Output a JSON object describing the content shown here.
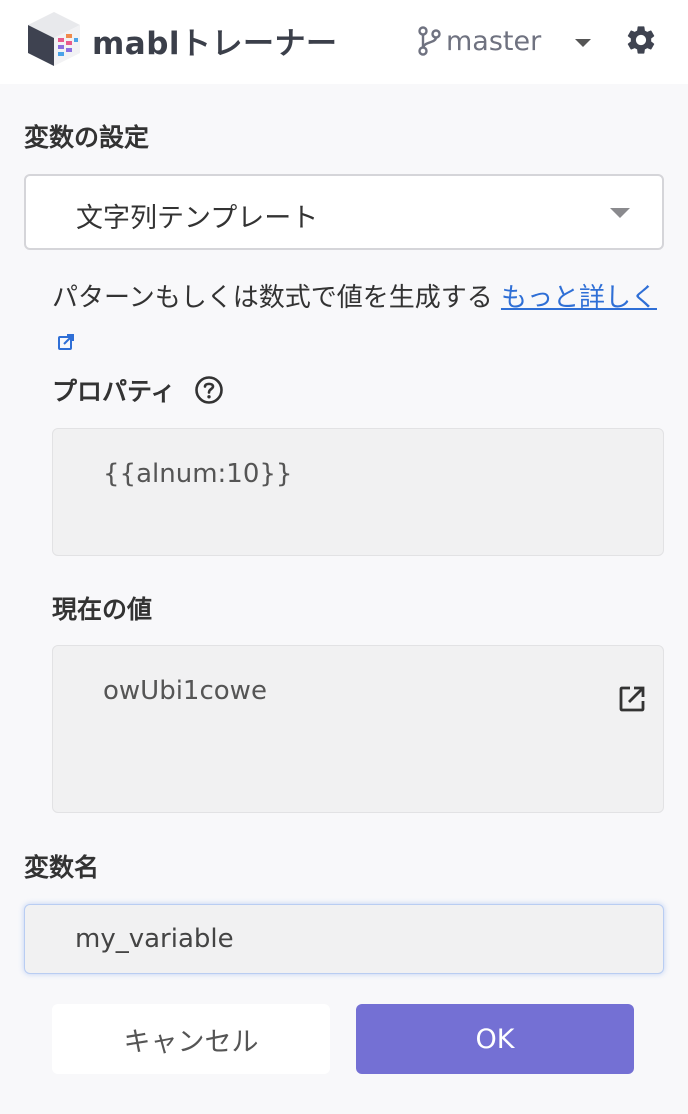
{
  "header": {
    "app_title": "mablトレーナー",
    "branch": "master"
  },
  "form": {
    "section_title": "変数の設定",
    "variable_type": "文字列テンプレート",
    "description": "パターンもしくは数式で値を生成する ",
    "learn_more": "もっと詳しく",
    "properties_title": "プロパティ",
    "template_value": "{{alnum:10}}",
    "current_value_title": "現在の値",
    "current_value": "owUbi1cowe",
    "variable_name_title": "変数名",
    "variable_name": "my_variable"
  },
  "buttons": {
    "cancel": "キャンセル",
    "ok": "OK"
  },
  "colors": {
    "accent": "#7470d4",
    "link": "#2f6fd6"
  }
}
